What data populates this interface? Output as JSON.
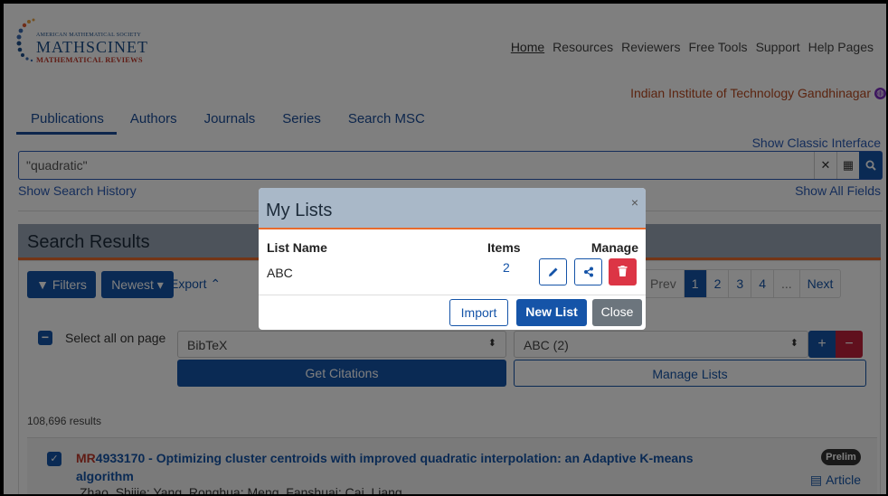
{
  "logo": {
    "ams": "AMERICAN MATHEMATICAL SOCIETY",
    "main": "MATHSCINET",
    "sub": "MATHEMATICAL REVIEWS"
  },
  "topnav": [
    "Home",
    "Resources",
    "Reviewers",
    "Free Tools",
    "Support",
    "Help Pages"
  ],
  "institution": "Indian Institute of Technology Gandhinagar",
  "tabs": [
    "Publications",
    "Authors",
    "Journals",
    "Series",
    "Search MSC"
  ],
  "show_classic": "Show Classic Interface",
  "search": {
    "value": "\"quadratic\""
  },
  "show_history": "Show Search History",
  "show_all_fields": "Show All Fields",
  "results": {
    "title": "Search Results",
    "filters_label": "Filters",
    "sort_label": "Newest",
    "export_label": "Export",
    "pager": [
      "Prev",
      "1",
      "2",
      "3",
      "4",
      "...",
      "Next"
    ],
    "select_all": "Select all on page",
    "format_select": "BibTeX",
    "list_select": "ABC (2)",
    "get_citations": "Get Citations",
    "manage_lists": "Manage Lists",
    "count": "108,696 results",
    "item": {
      "mr": "MR",
      "number": "4933170",
      "title": " - Optimizing cluster centroids with improved quadratic interpolation: an Adaptive K-means algorithm",
      "authors": "Zhao, Shijie; Yang, Ronghua; Meng, Fanshuai; Cai, Liang",
      "badge": "Prelim",
      "article": "Article"
    }
  },
  "modal": {
    "title": "My Lists",
    "close_x": "×",
    "col_name": "List Name",
    "col_items": "Items",
    "col_manage": "Manage",
    "list_name": "ABC",
    "list_items": "2",
    "import": "Import",
    "new_list": "New List",
    "close": "Close"
  },
  "colors": {
    "primary": "#1554a8",
    "accent": "#e86a2c",
    "danger": "#dc3545",
    "institution": "#b7481f"
  }
}
